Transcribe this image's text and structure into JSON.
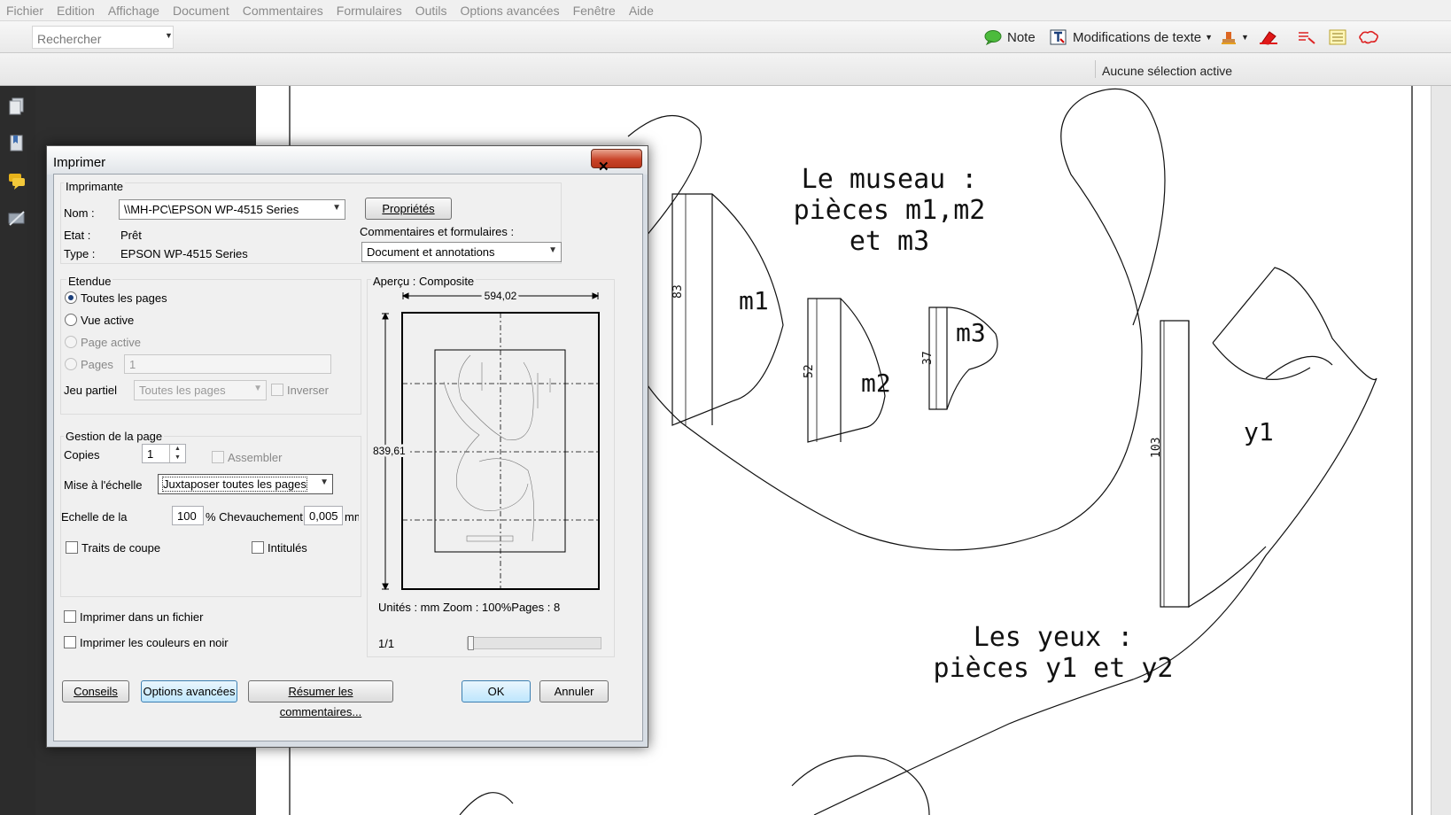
{
  "menu": [
    "Fichier",
    "Edition",
    "Affichage",
    "Document",
    "Commentaires",
    "Formulaires",
    "Outils",
    "Options avancées",
    "Fenêtre",
    "Aide"
  ],
  "toolbar": {
    "search_placeholder": "Rechercher",
    "note_label": "Note",
    "text_edits_label": "Modifications de texte"
  },
  "propbar": {
    "status": "Aucune sélection active"
  },
  "document": {
    "title_museau": [
      "Le museau :",
      "pièces m1,m2",
      "et m3"
    ],
    "title_yeux": [
      "Les yeux :",
      "pièces y1 et y2"
    ],
    "pieces": {
      "m1": "m1",
      "m2": "m2",
      "m3": "m3",
      "y1": "y1"
    },
    "dims": {
      "m1": "83",
      "m2": "52",
      "m3": "37",
      "y1": "103"
    }
  },
  "dialog": {
    "title": "Imprimer",
    "printer": {
      "group": "Imprimante",
      "name_label": "Nom :",
      "name_value": "\\\\MH-PC\\EPSON WP-4515 Series",
      "properties_btn": "Propriétés",
      "state_label": "Etat :",
      "state_value": "Prêt",
      "type_label": "Type :",
      "type_value": "EPSON WP-4515 Series",
      "comments_label": "Commentaires et formulaires :",
      "comments_value": "Document et annotations"
    },
    "range": {
      "group": "Etendue",
      "all_pages": "Toutes les pages",
      "current_view": "Vue active",
      "current_page": "Page active",
      "pages": "Pages",
      "pages_value": "1",
      "subset_label": "Jeu partiel",
      "subset_value": "Toutes les pages",
      "reverse": "Inverser"
    },
    "page_handling": {
      "group": "Gestion de la page",
      "copies_label": "Copies",
      "copies_value": "1",
      "collate": "Assembler",
      "scaling_label": "Mise à l'échelle",
      "scaling_value": "Juxtaposer toutes les pages",
      "scale_label": "Echelle de la",
      "scale_value": "100",
      "overlap_label": "% Chevauchement:",
      "overlap_value": "0,005",
      "overlap_unit": "mm",
      "cut_marks": "Traits de coupe",
      "labels": "Intitulés"
    },
    "print_to_file": "Imprimer dans un fichier",
    "print_black": "Imprimer les couleurs en noir",
    "preview": {
      "header": "Aperçu : Composite",
      "width": "594,02",
      "height": "839,61",
      "info": "Unités : mm Zoom : 100%Pages : 8",
      "page_counter": "1/1"
    },
    "buttons": {
      "tips": "Conseils",
      "advanced": "Options avancées",
      "summarize": "Résumer les commentaires...",
      "ok": "OK",
      "cancel": "Annuler"
    }
  }
}
